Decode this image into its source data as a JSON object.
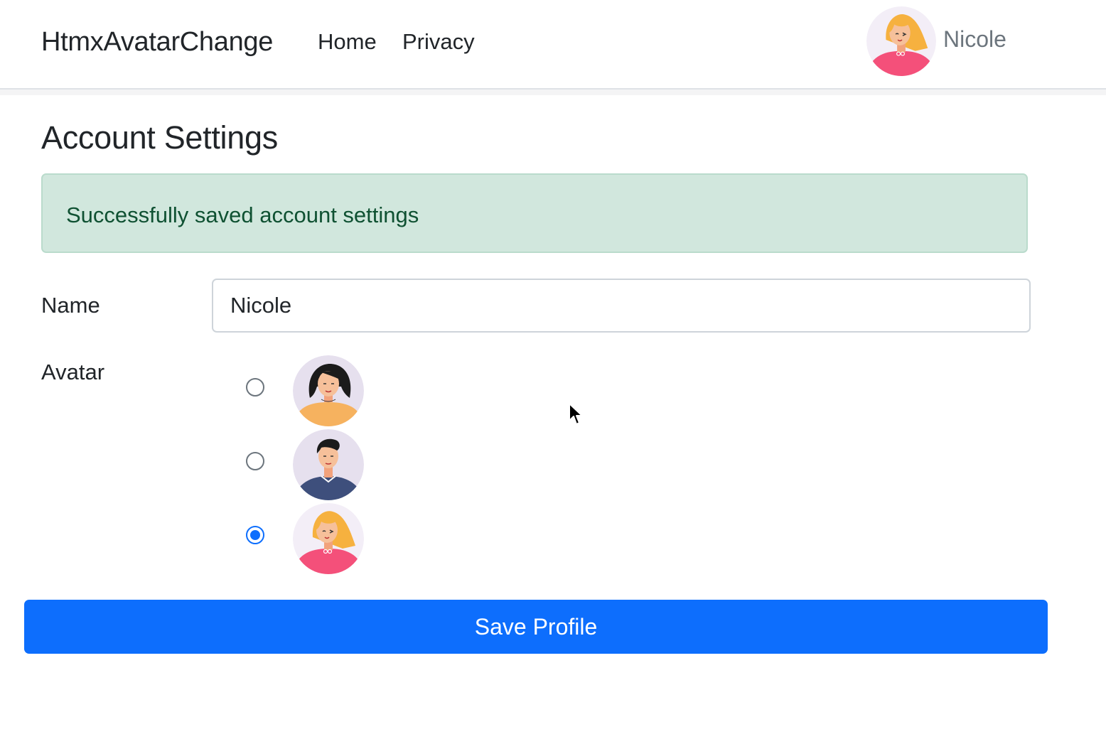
{
  "navbar": {
    "brand": "HtmxAvatarChange",
    "links": [
      {
        "label": "Home"
      },
      {
        "label": "Privacy"
      }
    ],
    "user": {
      "name": "Nicole",
      "avatar_icon": "woman-blonde-avatar-icon"
    }
  },
  "page": {
    "title": "Account Settings",
    "alert": {
      "text": "Successfully saved account settings",
      "bg": "#d1e7dd",
      "color": "#0f5132"
    },
    "form": {
      "name_label": "Name",
      "name_value": "Nicole",
      "avatar_label": "Avatar",
      "avatar_options": [
        {
          "icon": "woman-dark-hair-avatar-icon",
          "checked": false
        },
        {
          "icon": "man-dark-hair-avatar-icon",
          "checked": false
        },
        {
          "icon": "woman-blonde-avatar-icon",
          "checked": true
        }
      ],
      "save_label": "Save Profile"
    }
  },
  "colors": {
    "primary": "#0d6efd"
  }
}
